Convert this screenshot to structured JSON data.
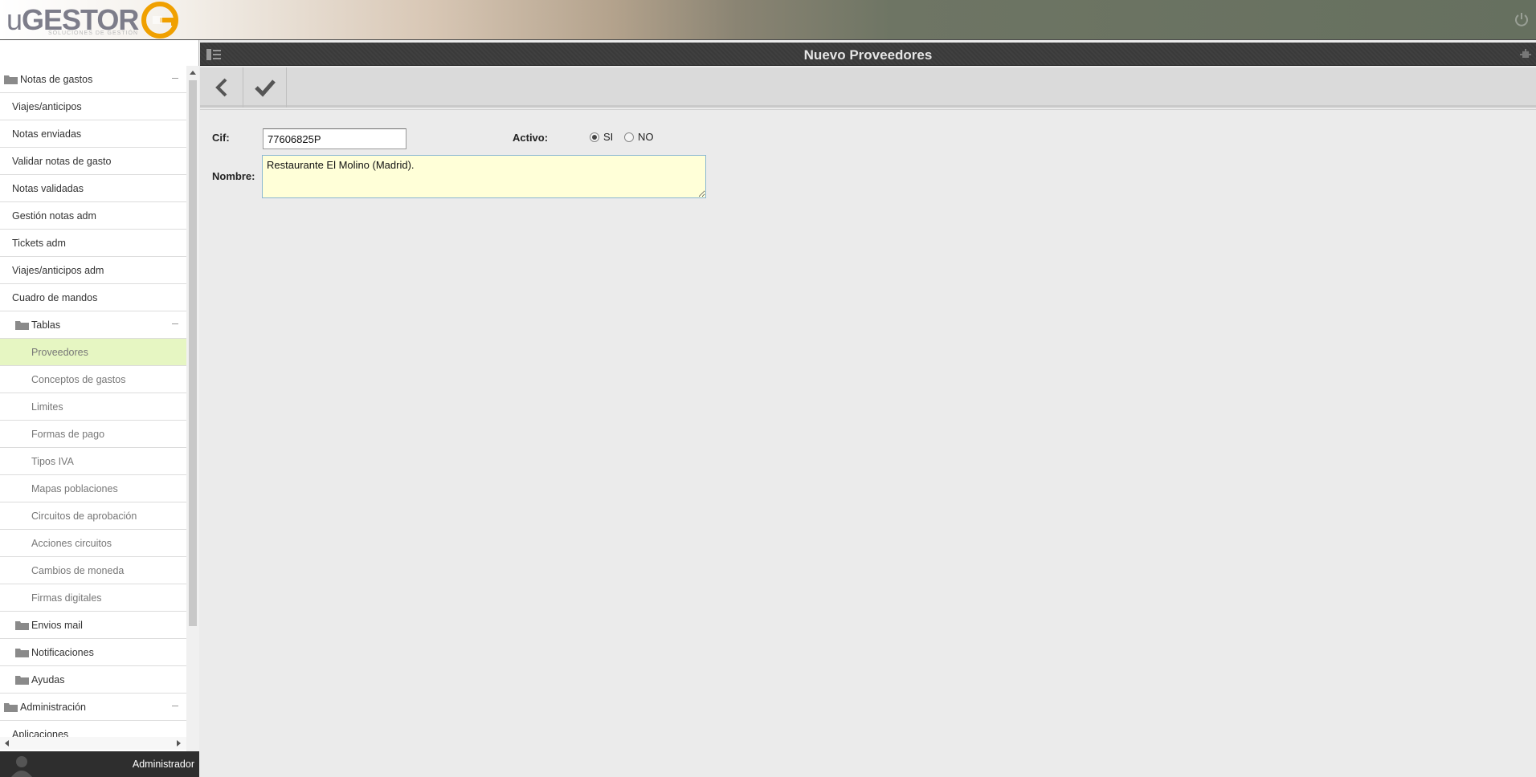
{
  "header": {
    "logo_prefix": "u",
    "logo_main": "GESTOR",
    "logo_tagline": "SOLUCIONES DE GESTIÓN",
    "power_icon": "power-icon"
  },
  "sidebar": {
    "items": [
      {
        "label": "Notas de gastos",
        "level": 0,
        "folder": true,
        "collapsible": true
      },
      {
        "label": "Viajes/anticipos",
        "level": 1
      },
      {
        "label": "Notas enviadas",
        "level": 1
      },
      {
        "label": "Validar notas de gasto",
        "level": 1
      },
      {
        "label": "Notas validadas",
        "level": 1
      },
      {
        "label": "Gestión notas adm",
        "level": 1
      },
      {
        "label": "Tickets adm",
        "level": 1
      },
      {
        "label": "Viajes/anticipos adm",
        "level": 1
      },
      {
        "label": "Cuadro de mandos",
        "level": 1
      },
      {
        "label": "Tablas",
        "level": 1,
        "folder": true,
        "collapsible": true
      },
      {
        "label": "Proveedores",
        "level": 2,
        "active": true
      },
      {
        "label": "Conceptos de gastos",
        "level": 2
      },
      {
        "label": "Limites",
        "level": 2
      },
      {
        "label": "Formas de pago",
        "level": 2
      },
      {
        "label": "Tipos IVA",
        "level": 2
      },
      {
        "label": "Mapas poblaciones",
        "level": 2
      },
      {
        "label": "Circuitos de aprobación",
        "level": 2
      },
      {
        "label": "Acciones circuitos",
        "level": 2
      },
      {
        "label": "Cambios de moneda",
        "level": 2
      },
      {
        "label": "Firmas digitales",
        "level": 2
      },
      {
        "label": "Envios mail",
        "level": 1,
        "folder": true
      },
      {
        "label": "Notificaciones",
        "level": 1,
        "folder": true
      },
      {
        "label": "Ayudas",
        "level": 1,
        "folder": true
      },
      {
        "label": "Administración",
        "level": 0,
        "folder": true,
        "collapsible": true
      },
      {
        "label": "Aplicaciones",
        "level": 1
      }
    ],
    "user_name": "Administrador"
  },
  "main": {
    "title": "Nuevo Proveedores",
    "toolbar": {
      "back_icon": "chevron-left-icon",
      "save_icon": "checkmark-icon"
    },
    "form": {
      "cif_label": "Cif:",
      "cif_value": "77606825P",
      "activo_label": "Activo:",
      "activo_options": [
        "SI",
        "NO"
      ],
      "activo_selected": "SI",
      "nombre_label": "Nombre:",
      "nombre_value": "Restaurante El Molino (Madrid). "
    }
  },
  "colors": {
    "active_item_bg": "#e6f6c2",
    "titlebar_bg": "#3a3a3a",
    "textarea_bg": "#ffffd8",
    "logo_accent": "#f0a000"
  }
}
